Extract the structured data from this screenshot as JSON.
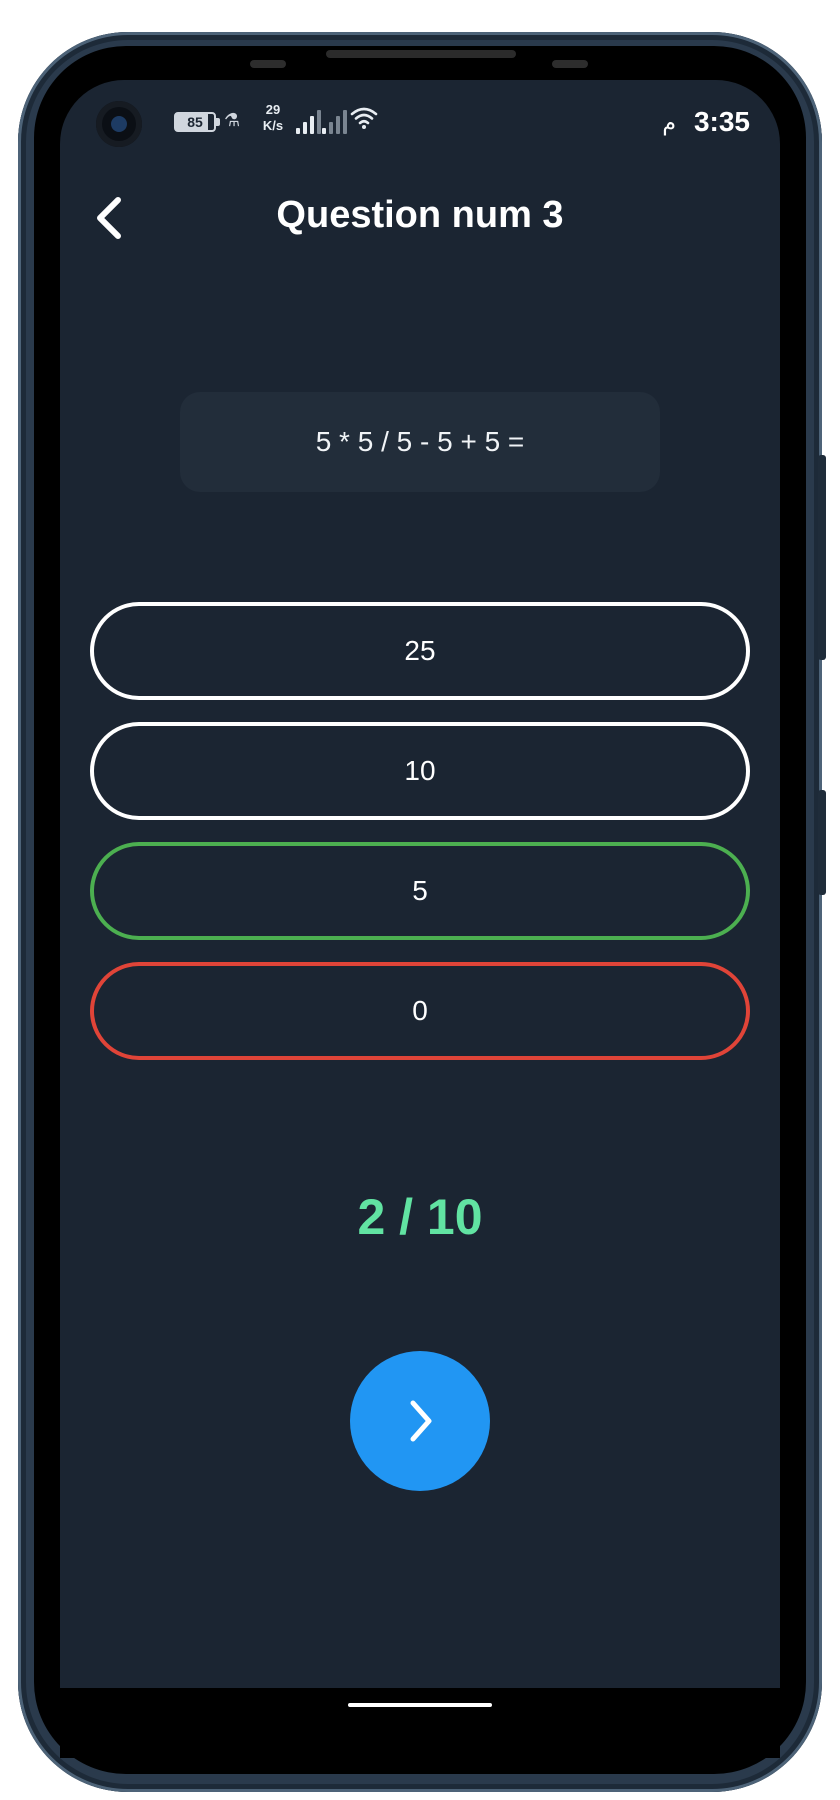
{
  "status_bar": {
    "battery": "85",
    "battery_level": 0.85,
    "net_speed_value": "29",
    "net_speed_unit": "K/s",
    "time": "3:35",
    "am_pm": "م"
  },
  "header": {
    "title": "Question num 3",
    "back_icon": "chevron-left-icon"
  },
  "question": {
    "text": "5 * 5 / 5 - 5 + 5 ="
  },
  "answers": [
    {
      "label": "25",
      "state": "default"
    },
    {
      "label": "10",
      "state": "default"
    },
    {
      "label": "5",
      "state": "correct"
    },
    {
      "label": "0",
      "state": "wrong"
    }
  ],
  "score": {
    "text": "2 / 10"
  },
  "next_button": {
    "icon": "chevron-right-icon"
  },
  "colors": {
    "background": "#1b2532",
    "card": "#222d3a",
    "correct": "#4caf50",
    "wrong": "#e04438",
    "score": "#61e3a2",
    "accent": "#2196f3"
  }
}
